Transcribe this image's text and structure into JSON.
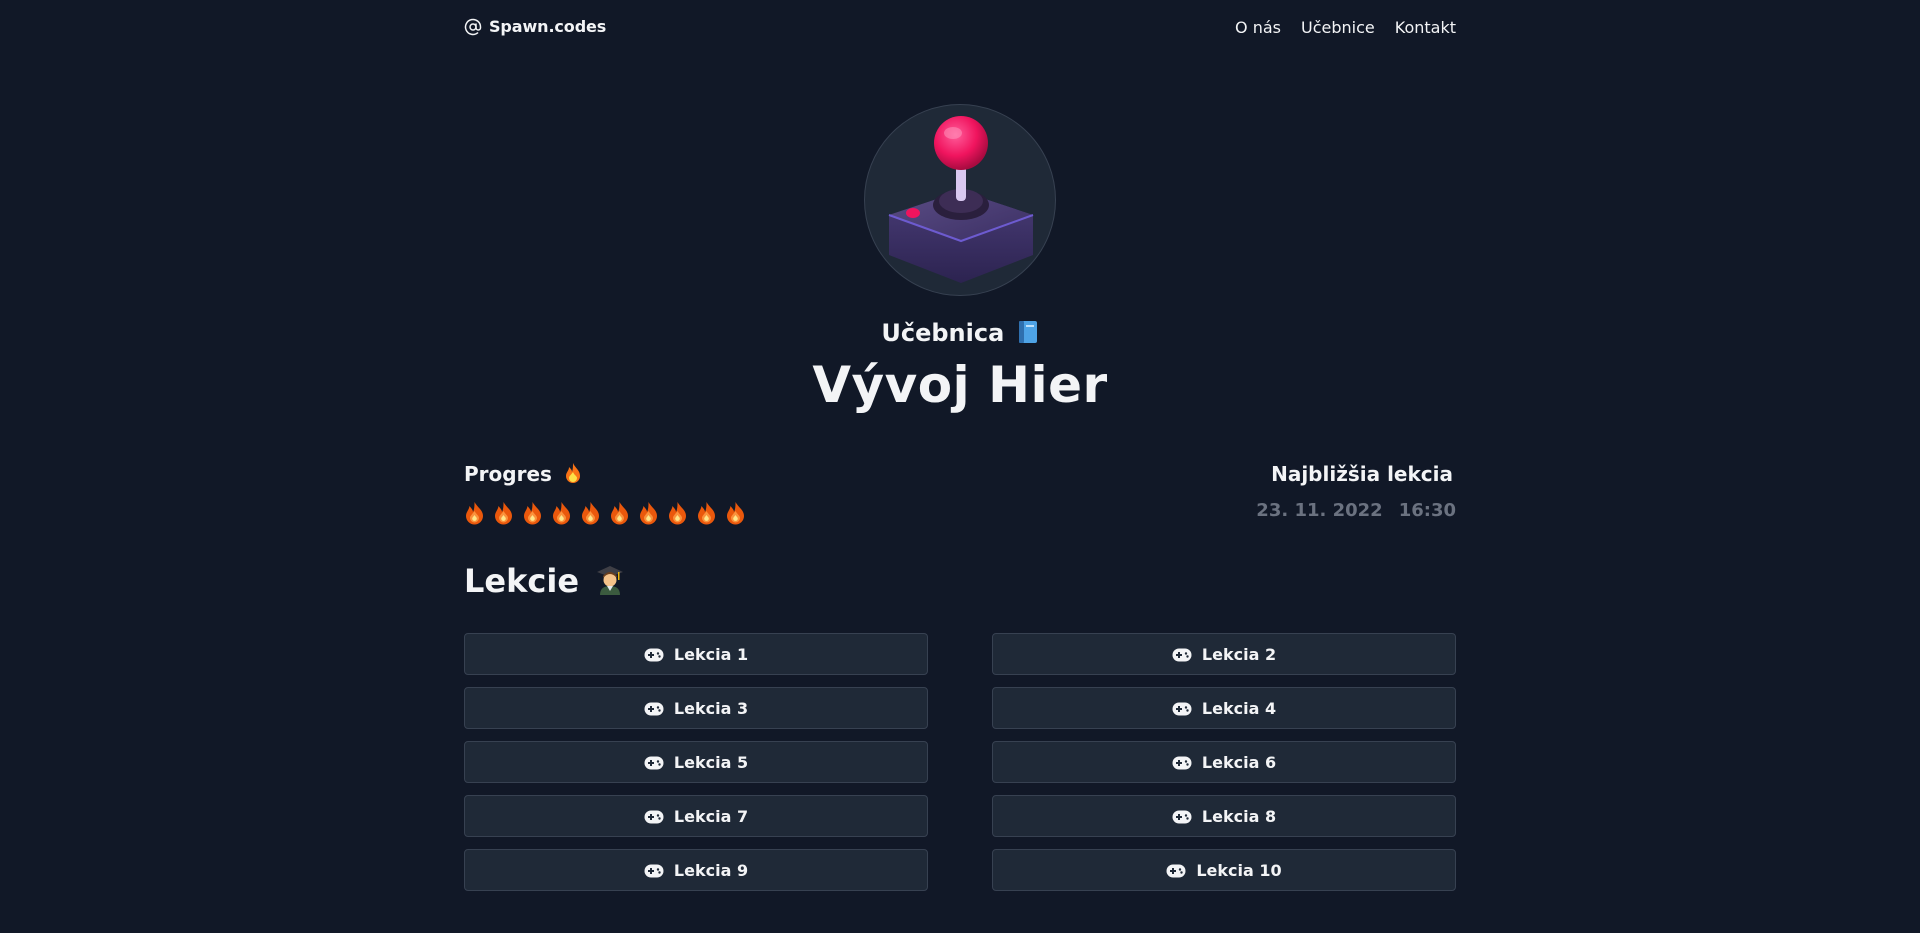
{
  "header": {
    "brand": "Spawn.codes",
    "nav": [
      {
        "label": "O nás"
      },
      {
        "label": "Učebnice"
      },
      {
        "label": "Kontakt"
      }
    ]
  },
  "hero": {
    "avatar_icon": "joystick-icon",
    "subtitle": "Učebnica",
    "subtitle_icon": "blue-book-icon",
    "title": "Vývoj Hier"
  },
  "progress": {
    "heading": "Progres",
    "heading_icon": "fire-icon",
    "completed": 10,
    "total": 10
  },
  "next_lesson": {
    "heading": "Najbližšia lekcia",
    "date": "23. 11. 2022",
    "time": "16:30"
  },
  "lessons": {
    "heading": "Lekcie",
    "heading_icon": "student-icon",
    "items": [
      {
        "label": "Lekcia 1",
        "icon": "gamepad-icon"
      },
      {
        "label": "Lekcia 2",
        "icon": "gamepad-icon"
      },
      {
        "label": "Lekcia 3",
        "icon": "gamepad-icon"
      },
      {
        "label": "Lekcia 4",
        "icon": "gamepad-icon"
      },
      {
        "label": "Lekcia 5",
        "icon": "gamepad-icon"
      },
      {
        "label": "Lekcia 6",
        "icon": "gamepad-icon"
      },
      {
        "label": "Lekcia 7",
        "icon": "gamepad-icon"
      },
      {
        "label": "Lekcia 8",
        "icon": "gamepad-icon"
      },
      {
        "label": "Lekcia 9",
        "icon": "gamepad-icon"
      },
      {
        "label": "Lekcia 10",
        "icon": "gamepad-icon"
      }
    ]
  },
  "colors": {
    "background": "#111827",
    "card": "#1f2937",
    "muted_text": "#6b7280",
    "accent": "#f43f5e"
  }
}
